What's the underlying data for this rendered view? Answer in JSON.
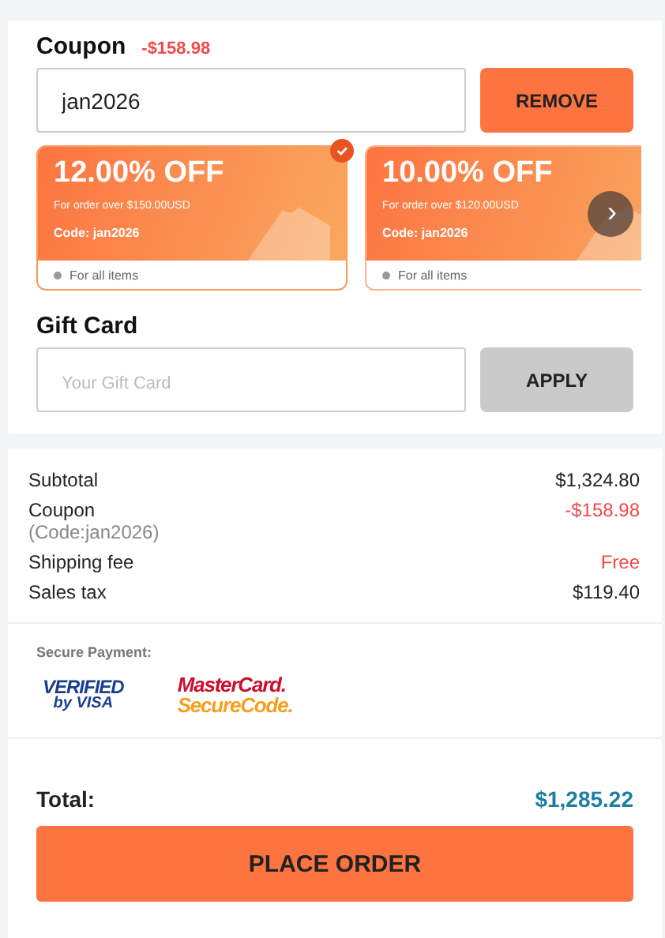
{
  "coupon": {
    "title": "Coupon",
    "discount": "-$158.98",
    "code_value": "jan2026",
    "remove_button": "REMOVE",
    "offers": [
      {
        "headline": "12.00% OFF",
        "condition": "For order over $150.00USD",
        "code": "Code: jan2026",
        "scope": "For all items",
        "selected": true
      },
      {
        "headline": "10.00% OFF",
        "condition": "For order over $120.00USD",
        "code": "Code: jan2026",
        "scope": "For all items",
        "selected": false
      }
    ],
    "next_icon": "›"
  },
  "gift_card": {
    "title": "Gift Card",
    "placeholder": "Your Gift Card",
    "apply_button": "APPLY",
    "apply_disabled": true
  },
  "summary": [
    {
      "label": "Subtotal",
      "value": "$1,324.80",
      "kind": "plain"
    },
    {
      "label": "Coupon",
      "sublabel": "(Code:jan2026)",
      "value": "-$158.98",
      "kind": "highlight"
    },
    {
      "label": "Shipping fee",
      "value": "Free",
      "kind": "highlight"
    },
    {
      "label": "Sales tax",
      "value": "$119.40",
      "kind": "plain"
    }
  ],
  "secure_payment": {
    "title": "Secure Payment:",
    "visa": [
      "VERIFIED",
      "by VISA"
    ],
    "mastercard": [
      "MasterCard.",
      "SecureCode."
    ]
  },
  "total": {
    "label": "Total:",
    "value": "$1,285.22"
  },
  "place_order_button": "PLACE ORDER"
}
